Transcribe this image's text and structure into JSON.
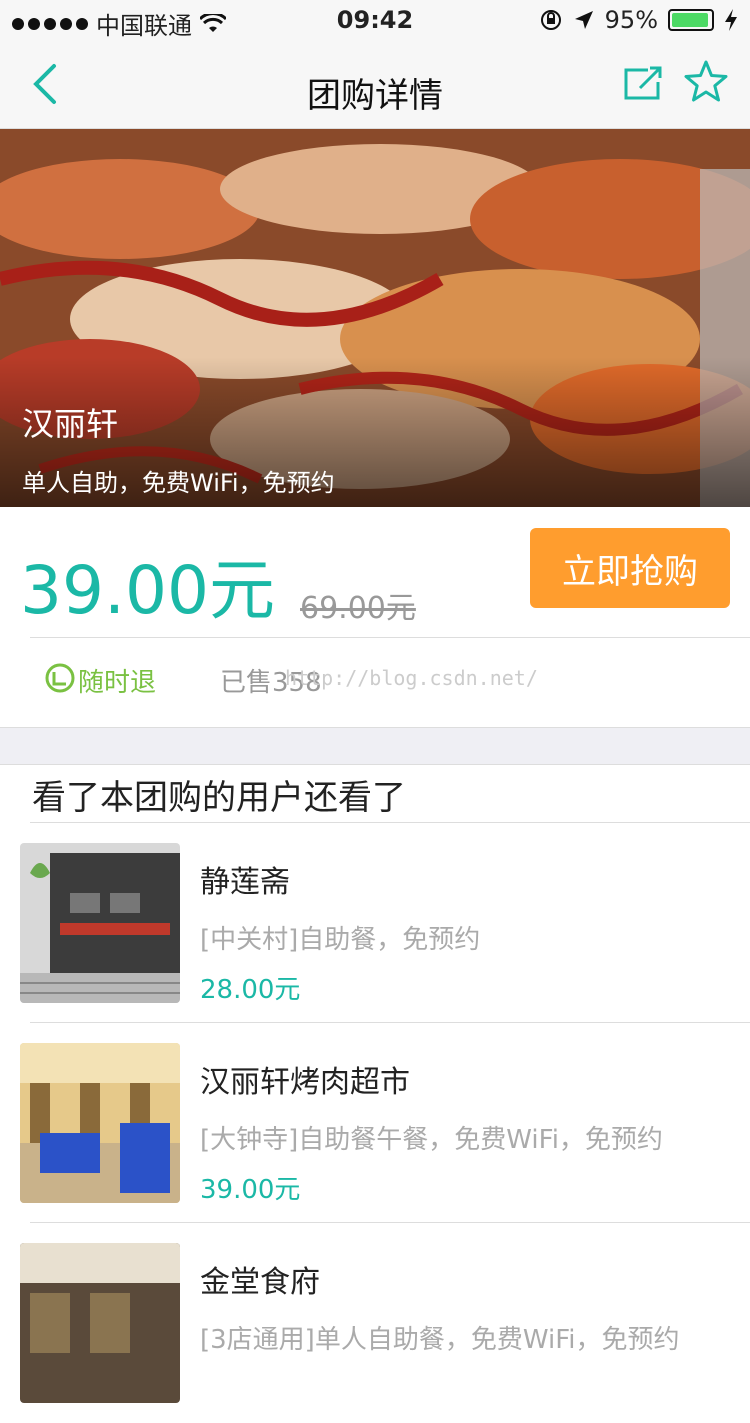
{
  "status": {
    "carrier": "中国联通",
    "time": "09:42",
    "battery": "95%",
    "battery_level": 0.95
  },
  "nav": {
    "title": "团购详情"
  },
  "hero": {
    "title": "汉丽轩",
    "subtitle": "单人自助，免费WiFi，免预约"
  },
  "deal": {
    "price": "39.00元",
    "original_price": "69.00元",
    "buy_label": "立即抢购",
    "refund_label": "随时退",
    "sold_label": "已售358",
    "watermark": "http://blog.csdn.net/"
  },
  "recommend": {
    "title": "看了本团购的用户还看了",
    "items": [
      {
        "name": "静莲斋",
        "desc": "[中关村]自助餐，免预约",
        "price": "28.00元"
      },
      {
        "name": "汉丽轩烤肉超市",
        "desc": "[大钟寺]自助餐午餐，免费WiFi，免预约",
        "price": "39.00元"
      },
      {
        "name": "金堂食府",
        "desc": "[3店通用]单人自助餐，免费WiFi，免预约",
        "price": ""
      }
    ]
  },
  "colors": {
    "accent": "#1bb8a6",
    "buy": "#ff9d2e",
    "refund": "#7ac142"
  }
}
